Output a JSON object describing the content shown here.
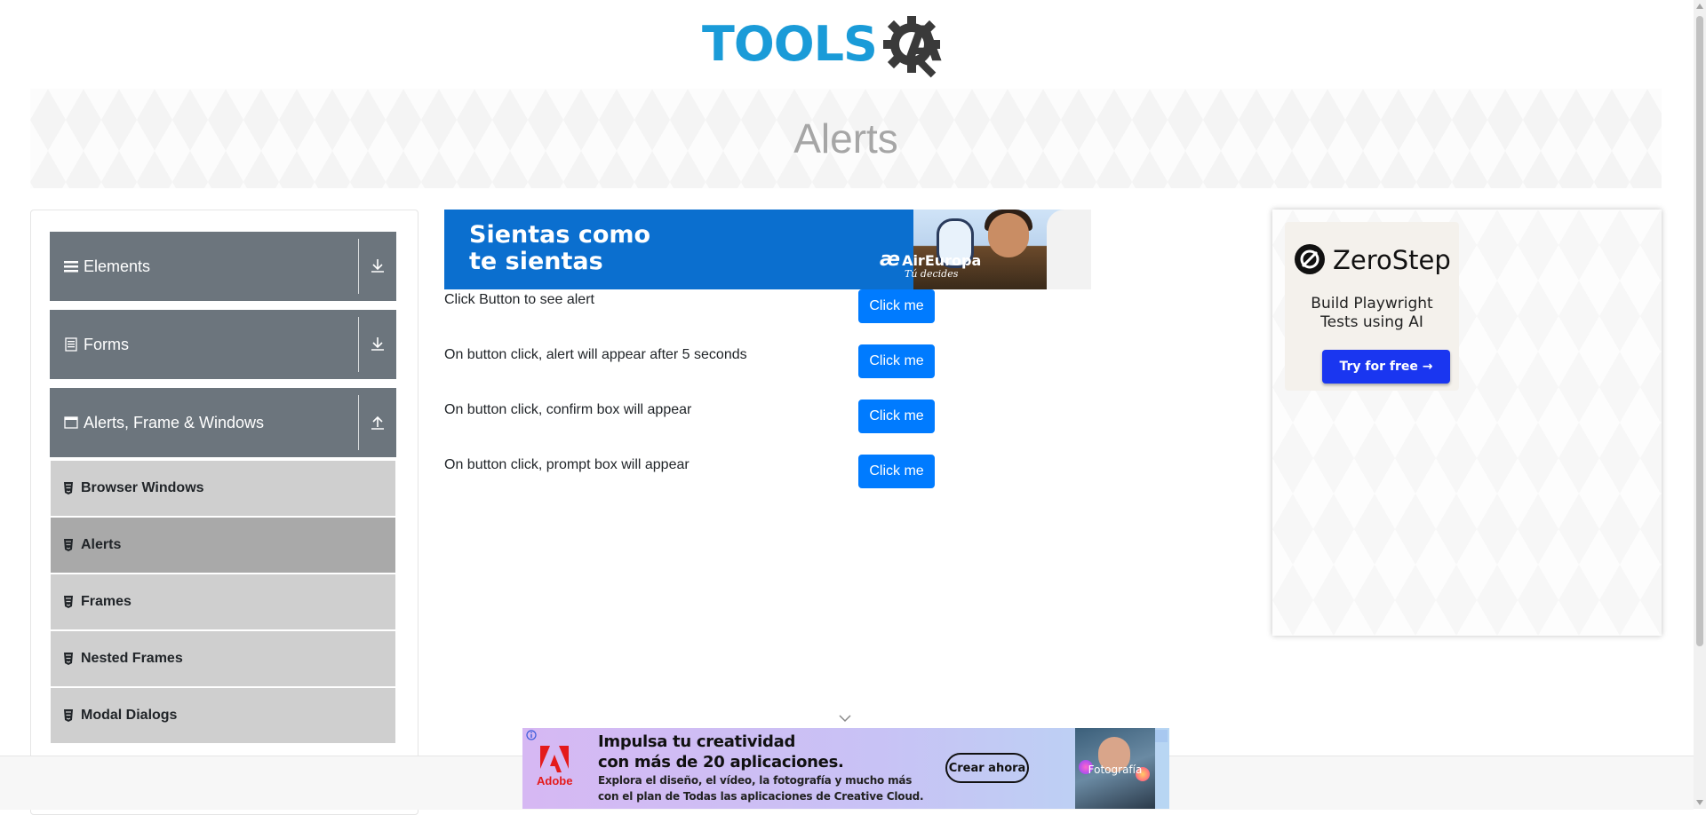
{
  "header": {
    "logo_part1": "TOOLS",
    "logo_part2": "A",
    "brand_colors": {
      "tools": "#1a9bd8",
      "qa": "#3a3a3a"
    }
  },
  "page_title": "Alerts",
  "sidebar": {
    "groups": [
      {
        "label": "Elements",
        "icon": "list-icon",
        "state": "collapsed"
      },
      {
        "label": "Forms",
        "icon": "form-icon",
        "state": "collapsed"
      },
      {
        "label": "Alerts, Frame & Windows",
        "icon": "window-icon",
        "state": "expanded"
      }
    ],
    "items": [
      {
        "label": "Browser Windows",
        "active": false
      },
      {
        "label": "Alerts",
        "active": true
      },
      {
        "label": "Frames",
        "active": false
      },
      {
        "label": "Nested Frames",
        "active": false
      },
      {
        "label": "Modal Dialogs",
        "active": false
      }
    ]
  },
  "ad_top": {
    "line1": "Sientas como",
    "line2": "te sientas",
    "brand": "AirEuropa",
    "tagline": "Tú decides",
    "bg_color": "#0b6fcf"
  },
  "alerts": [
    {
      "text": "Click Button to see alert",
      "button": "Click me"
    },
    {
      "text": "On button click, alert will appear after 5 seconds",
      "button": "Click me"
    },
    {
      "text": "On button click, confirm box will appear",
      "button": "Click me"
    },
    {
      "text": "On button click, prompt box will appear",
      "button": "Click me"
    }
  ],
  "right_ad": {
    "brand": "ZeroStep",
    "tagline_line1": "Build Playwright",
    "tagline_line2": "Tests using AI",
    "cta": "Try for free →",
    "cta_color": "#1a36f0"
  },
  "ad_bottom": {
    "brand": "Adobe",
    "headline_line1": "Impulsa tu creatividad",
    "headline_line2": "con más de 20 aplicaciones.",
    "body_line1": "Explora el diseño, el vídeo, la fotografía y mucho más",
    "body_line2": "con el plan de Todas las aplicaciones de Creative Cloud.",
    "cta": "Crear ahora",
    "thumb_label": "Fotografía"
  },
  "accent_color": "#007bff"
}
